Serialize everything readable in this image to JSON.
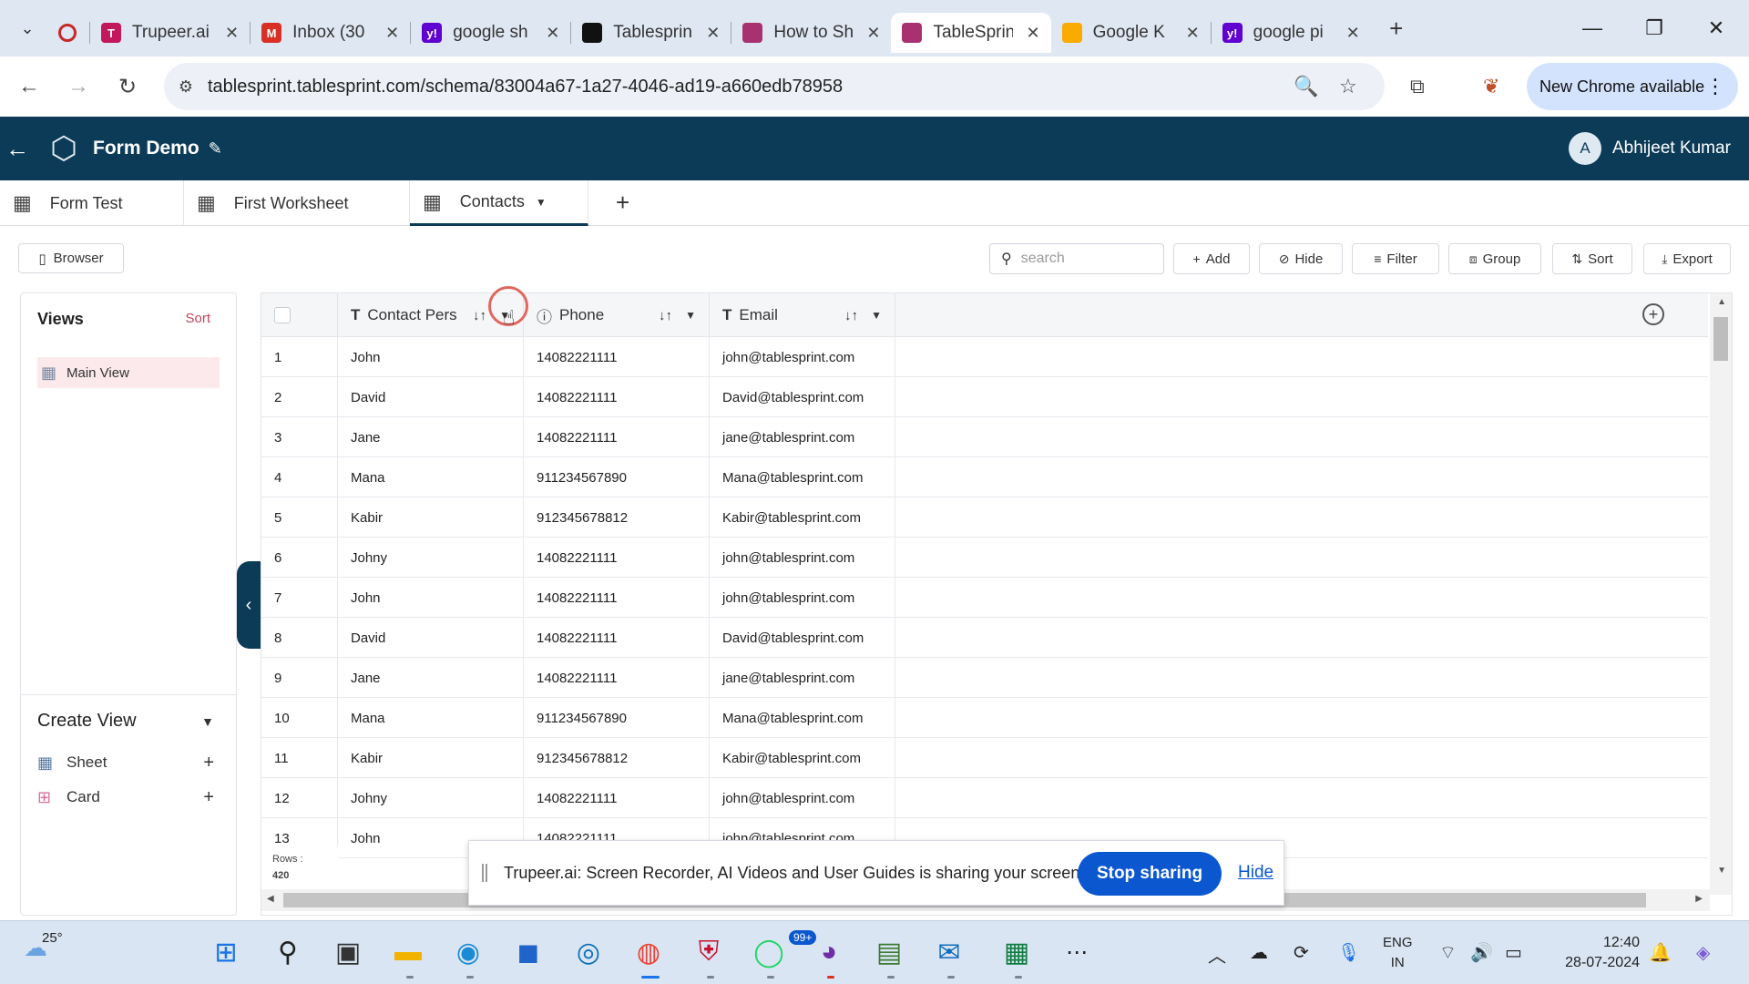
{
  "browser": {
    "tabs": [
      {
        "title": "",
        "favicon": "record-icon",
        "color": "#c62828",
        "close": ""
      },
      {
        "title": "Trupeer.ai",
        "favicon": "T",
        "color": "#c2185b",
        "close": "✕"
      },
      {
        "title": "Inbox (30",
        "favicon": "M",
        "color": "#d93025",
        "close": "✕"
      },
      {
        "title": "google sh",
        "favicon": "y!",
        "color": "#5f01d1",
        "close": "✕"
      },
      {
        "title": "Tablesprin",
        "favicon": "github-icon",
        "color": "#111",
        "close": "✕"
      },
      {
        "title": "How to Sh",
        "favicon": "cube-icon",
        "color": "#a7326f",
        "close": "✕"
      },
      {
        "title": "TableSprin",
        "favicon": "cube-icon",
        "color": "#a7326f",
        "close": "✕",
        "active": true
      },
      {
        "title": "Google K",
        "favicon": "keep-icon",
        "color": "#f9ab00",
        "close": "✕"
      },
      {
        "title": "google pi",
        "favicon": "y!",
        "color": "#5f01d1",
        "close": "✕"
      }
    ],
    "url": "tablesprint.tablesprint.com/schema/83004a67-1a27-4046-ad19-a660edb78958",
    "update_label": "New Chrome available"
  },
  "app": {
    "name": "Form Demo",
    "user_initial": "A",
    "user_name": "Abhijeet Kumar",
    "brand_color": "#0b3b57"
  },
  "sheets": [
    "Form Test",
    "First Worksheet",
    "Contacts"
  ],
  "toolbar": {
    "browser_label": "Browser",
    "search_placeholder": "search",
    "add_label": "Add",
    "hide_label": "Hide",
    "filter_label": "Filter",
    "group_label": "Group",
    "sort_label": "Sort",
    "export_label": "Export"
  },
  "views": {
    "title": "Views",
    "sort_label": "Sort",
    "main_view": "Main View",
    "create_title": "Create View",
    "create_items": [
      "Sheet",
      "Card"
    ]
  },
  "grid": {
    "columns": [
      "Contact Pers",
      "Phone",
      "Email"
    ],
    "rows": [
      [
        "1",
        "John",
        "14082221111",
        "john@tablesprint.com"
      ],
      [
        "2",
        "David",
        "14082221111",
        "David@tablesprint.com"
      ],
      [
        "3",
        "Jane",
        "14082221111",
        "jane@tablesprint.com"
      ],
      [
        "4",
        "Mana",
        "911234567890",
        "Mana@tablesprint.com"
      ],
      [
        "5",
        "Kabir",
        "912345678812",
        "Kabir@tablesprint.com"
      ],
      [
        "6",
        "Johny",
        "14082221111",
        "john@tablesprint.com"
      ],
      [
        "7",
        "John",
        "14082221111",
        "john@tablesprint.com"
      ],
      [
        "8",
        "David",
        "14082221111",
        "David@tablesprint.com"
      ],
      [
        "9",
        "Jane",
        "14082221111",
        "jane@tablesprint.com"
      ],
      [
        "10",
        "Mana",
        "911234567890",
        "Mana@tablesprint.com"
      ],
      [
        "11",
        "Kabir",
        "912345678812",
        "Kabir@tablesprint.com"
      ],
      [
        "12",
        "Johny",
        "14082221111",
        "john@tablesprint.com"
      ],
      [
        "13",
        "John",
        "14082221111",
        "john@tablesprint.com"
      ]
    ],
    "rows_label": "Rows :",
    "rows_count": "420"
  },
  "sharing": {
    "message": "Trupeer.ai: Screen Recorder, AI Videos and User Guides is sharing your screen.",
    "stop_label": "Stop sharing",
    "hide_label": "Hide"
  },
  "taskbar": {
    "temperature": "25°",
    "badge": "99+",
    "lang_line1": "ENG",
    "lang_line2": "IN",
    "time": "12:40",
    "date": "28-07-2024"
  }
}
